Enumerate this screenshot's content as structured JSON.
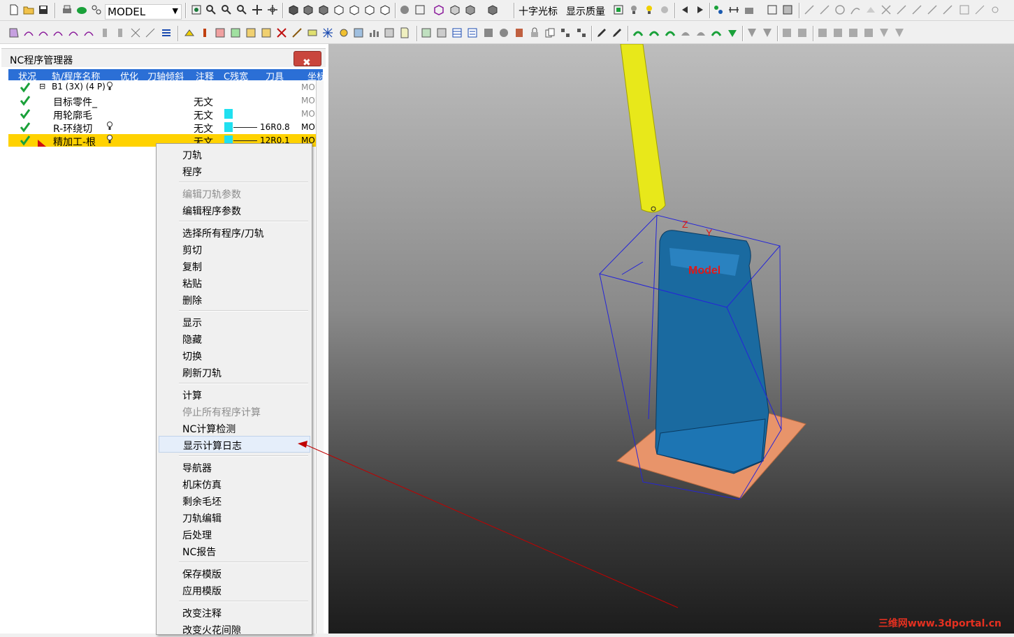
{
  "toolbar": {
    "model_select": "MODEL",
    "crosshair_label": "十字光标",
    "display_quality_label": "显示质量"
  },
  "panel": {
    "title": "NC程序管理器",
    "close_glyph": "✖",
    "columns": [
      "状况",
      "轨/程序名称",
      "优化",
      "刀轴倾斜",
      "注释",
      "C残宽",
      "刀具",
      "坐标"
    ],
    "rows": [
      {
        "name": "B1 (3X) (4 P)",
        "note": "",
        "tool": "",
        "coord": "MOD",
        "expander": "⊟"
      },
      {
        "name": "目标零件_",
        "note": "无文",
        "tool": "",
        "coord": "MOD"
      },
      {
        "name": "用轮廓毛",
        "note": "无文",
        "tool": "",
        "coord": "MOD"
      },
      {
        "name": "R-环绕切",
        "note": "无文",
        "tool": "16R0.8",
        "coord": "MOD"
      },
      {
        "name": "精加工-根",
        "note": "无文",
        "tool": "12R0.1",
        "coord": "MOD"
      }
    ]
  },
  "context_menu": {
    "items": [
      {
        "label": "刀轨"
      },
      {
        "label": "程序"
      },
      {
        "label": "编辑刀轨参数"
      },
      {
        "label": "编辑程序参数"
      },
      {
        "label": "选择所有程序/刀轨"
      },
      {
        "label": "剪切"
      },
      {
        "label": "复制"
      },
      {
        "label": "粘贴"
      },
      {
        "label": "删除"
      },
      {
        "label": "显示"
      },
      {
        "label": "隐藏"
      },
      {
        "label": "切换"
      },
      {
        "label": "刷新刀轨"
      },
      {
        "label": "计算"
      },
      {
        "label": "停止所有程序计算"
      },
      {
        "label": "NC计算检测"
      },
      {
        "label": "显示计算日志"
      },
      {
        "label": "导航器"
      },
      {
        "label": "机床仿真"
      },
      {
        "label": "剩余毛坯"
      },
      {
        "label": "刀轨编辑"
      },
      {
        "label": "后处理"
      },
      {
        "label": "NC报告"
      },
      {
        "label": "保存模版"
      },
      {
        "label": "应用模版"
      },
      {
        "label": "改变注释"
      },
      {
        "label": "改变火花间隙"
      }
    ],
    "disabled": [
      "编辑刀轨参数",
      "停止所有程序计算"
    ],
    "highlighted": "显示计算日志"
  },
  "viewport": {
    "axis_z": "Z",
    "axis_y": "Y",
    "model_label": "Model",
    "watermark": "三维网www.3dportal.cn"
  },
  "colors": {
    "tool": "#e8e81a",
    "part": "#1a6aa0",
    "stock": "#e8946a",
    "selection": "#ffd200",
    "header": "#2b6fd6",
    "annotation_line": "#c00000"
  }
}
